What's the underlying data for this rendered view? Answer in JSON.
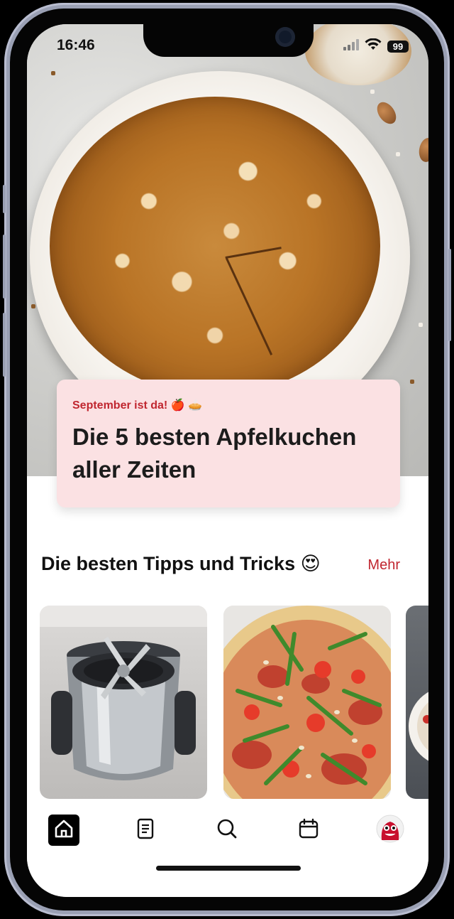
{
  "status": {
    "time": "16:46",
    "battery": "99"
  },
  "feature": {
    "kicker": "September ist da! 🍎 🥧",
    "title": "Die 5 besten Apfelkuchen aller Zeiten"
  },
  "section": {
    "title": "Die besten Tipps und Tricks 😍",
    "more_label": "Mehr"
  },
  "tips": [
    {
      "image": "blender-appliance"
    },
    {
      "image": "pizza-arugula-prosciutto"
    },
    {
      "image": "partial-dish"
    }
  ],
  "tabbar": {
    "items": [
      {
        "icon": "home-icon",
        "active": true
      },
      {
        "icon": "document-icon",
        "active": false
      },
      {
        "icon": "search-icon",
        "active": false
      },
      {
        "icon": "calendar-icon",
        "active": false
      },
      {
        "icon": "avatar",
        "active": false
      }
    ]
  },
  "colors": {
    "accent": "#c0262f",
    "card_bg": "#fbe1e3"
  }
}
